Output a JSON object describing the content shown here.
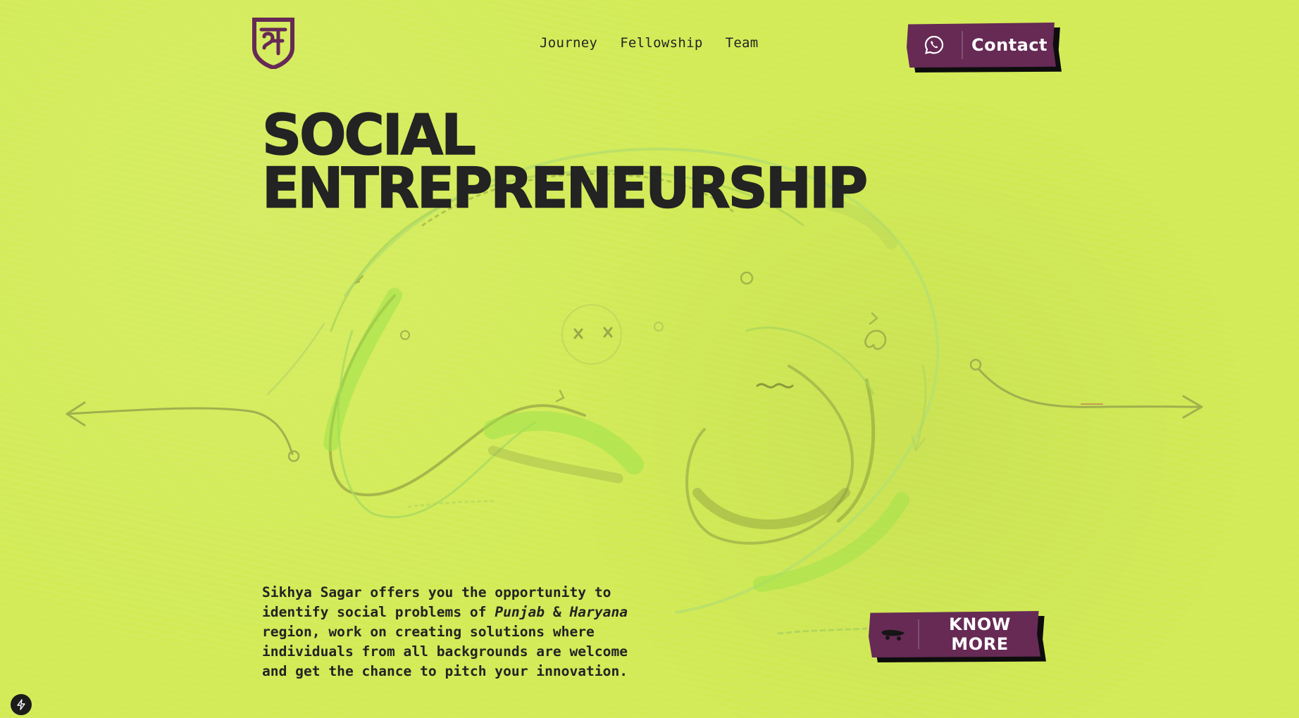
{
  "brand": {
    "logo_icon": "sikhya-sagar-shield-logo-icon"
  },
  "nav": {
    "items": [
      {
        "label": "Journey"
      },
      {
        "label": "Fellowship"
      },
      {
        "label": "Team"
      }
    ]
  },
  "header": {
    "contact_label": "Contact",
    "contact_icon": "whatsapp-icon"
  },
  "hero": {
    "title_line1": "SOCIAL",
    "title_line2": "ENTREPRENEURSHIP",
    "desc_part1": "Sikhya Sagar offers you the opportunity to identify social problems of ",
    "desc_place1": "Punjab",
    "desc_amp": " & ",
    "desc_place2": "Haryana",
    "desc_part2": " region, work on creating solutions where individuals from all backgrounds are welcome and get the chance to pitch your innovation.",
    "cta_label": "KNOW MORE",
    "cta_icon": "skateboard-icon"
  },
  "colors": {
    "background": "#d2eb56",
    "accent": "#662a55",
    "text": "#232323"
  },
  "misc": {
    "corner_icon": "lightning-bolt-icon"
  }
}
